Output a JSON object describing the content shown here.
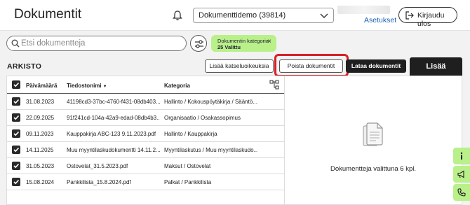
{
  "header": {
    "title": "Dokumentit",
    "company_selector": "Dokumenttidemo (39814)",
    "settings_link": "Asetukset",
    "logout_label": "Kirjaudu ulos"
  },
  "search": {
    "placeholder": "Etsi dokumentteja",
    "value": ""
  },
  "filter_chip": {
    "line1": "Dokumentin kategoria",
    "line2": "25 Valittu",
    "remove": "×"
  },
  "toolbar": {
    "section_label": "ARKISTO",
    "add_view_label": "Lisää katseluoikeuksia",
    "delete_label": "Poista dokumentit",
    "download_label": "Lataa dokumentit",
    "more_label": "Lisää"
  },
  "table": {
    "columns": {
      "date": "Päivämäärä",
      "file": "Tiedostonimi",
      "category": "Kategoria"
    },
    "rows": [
      {
        "date": "31.08.2023",
        "file": "41198cd3-37bc-4760-f431-08db403...",
        "category": "Hallinto / Kokouspöytäkirja / Sääntö...",
        "checked": true
      },
      {
        "date": "22.09.2025",
        "file": "91f241cd-104a-42a9-edad-08db4b3...",
        "category": "Organisaatio / Osakassopimus",
        "checked": true
      },
      {
        "date": "09.11.2023",
        "file": "Kauppakirja ABC-123 9.11.2023.pdf",
        "category": "Hallinto / Kauppakirja",
        "checked": true
      },
      {
        "date": "14.11.2025",
        "file": "Muu myyntilaskudokumentti 14.11.2...",
        "category": "Myyntilaskutus / Muu myyntilaskudo...",
        "checked": true
      },
      {
        "date": "31.05.2023",
        "file": "Ostovelat_31.5.2023.pdf",
        "category": "Maksut / Ostovelat",
        "checked": true
      },
      {
        "date": "15.08.2024",
        "file": "Pankkilista_15.8.2024.pdf",
        "category": "Palkat / Pankkilista",
        "checked": true
      }
    ]
  },
  "panel": {
    "selected_text": "Dokumentteja valittuna 6 kpl."
  },
  "colors": {
    "accent_green": "#b9f08a",
    "highlight_red": "#d91f26",
    "dark": "#1f1f1f",
    "link": "#1a5fb4"
  }
}
